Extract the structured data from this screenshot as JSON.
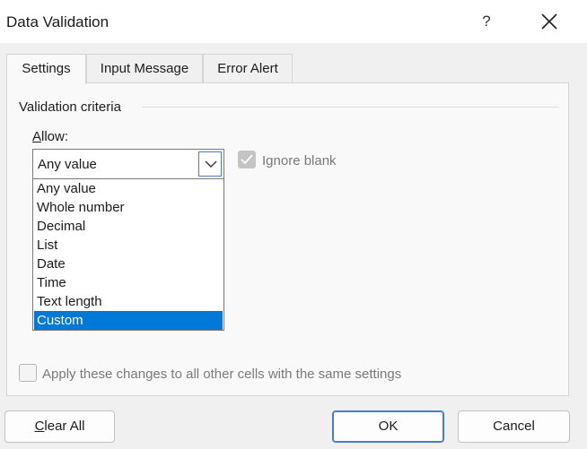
{
  "window": {
    "title": "Data Validation",
    "help_label": "?"
  },
  "tabs": [
    {
      "label": "Settings",
      "active": true
    },
    {
      "label": "Input Message",
      "active": false
    },
    {
      "label": "Error Alert",
      "active": false
    }
  ],
  "settings": {
    "group_label": "Validation criteria",
    "allow_label": "Allow:",
    "allow_value": "Any value",
    "ignore_blank_label": "Ignore blank",
    "ignore_blank_checked": true,
    "options": [
      "Any value",
      "Whole number",
      "Decimal",
      "List",
      "Date",
      "Time",
      "Text length",
      "Custom"
    ],
    "highlighted_option": "Custom",
    "apply_label": "Apply these changes to all other cells with the same settings",
    "apply_checked": false
  },
  "buttons": {
    "clear_all": "Clear All",
    "ok": "OK",
    "cancel": "Cancel"
  },
  "colors": {
    "selection": "#0078d7",
    "focus_border": "#4a7bc4"
  },
  "icons": {
    "close": "close-icon",
    "dropdown": "chevron-down-icon",
    "check": "checkmark-icon"
  }
}
